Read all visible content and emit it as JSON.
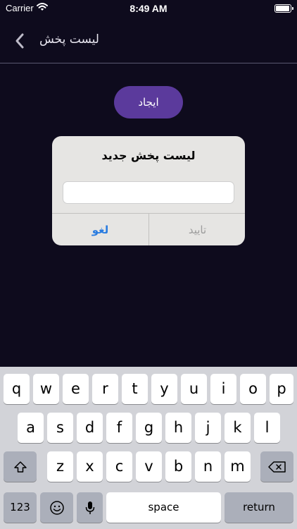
{
  "status_bar": {
    "carrier": "Carrier",
    "time": "8:49 AM"
  },
  "nav": {
    "title": "لیست پخش",
    "back_icon": "chevron-left-icon"
  },
  "main": {
    "create_label": "ایجاد"
  },
  "alert": {
    "title": "لیست پخش جدید",
    "input_value": "",
    "cancel_label": "لغو",
    "confirm_label": "تایید"
  },
  "keyboard": {
    "row1": [
      "q",
      "w",
      "e",
      "r",
      "t",
      "y",
      "u",
      "i",
      "o",
      "p"
    ],
    "row2": [
      "a",
      "s",
      "d",
      "f",
      "g",
      "h",
      "j",
      "k",
      "l"
    ],
    "row3": [
      "z",
      "x",
      "c",
      "v",
      "b",
      "n",
      "m"
    ],
    "numbers_label": "123",
    "space_label": "space",
    "return_label": "return",
    "icons": {
      "shift": "shift-icon",
      "delete": "delete-icon",
      "emoji": "emoji-icon",
      "mic": "microphone-icon"
    }
  },
  "colors": {
    "background": "#0e0b1d",
    "accent": "#5b3a9c",
    "link": "#2a7ce0"
  }
}
